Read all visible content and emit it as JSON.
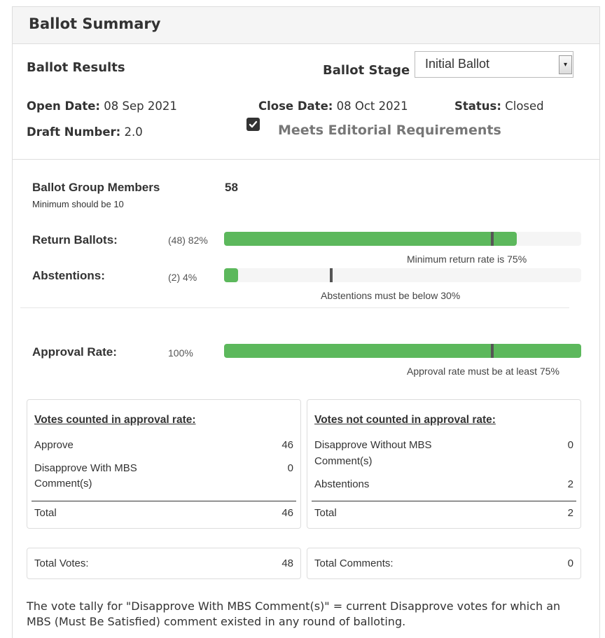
{
  "panel": {
    "title": "Ballot Summary"
  },
  "results": {
    "title": "Ballot Results",
    "stage_label": "Ballot Stage",
    "stage_value": "Initial Ballot",
    "open_date_label": "Open Date:",
    "open_date": "08 Sep 2021",
    "close_date_label": "Close Date:",
    "close_date": "08 Oct 2021",
    "status_label": "Status:",
    "status": "Closed",
    "draft_label": "Draft Number:",
    "draft": "2.0",
    "editorial_label": "Meets Editorial Requirements",
    "editorial_checked": true
  },
  "members": {
    "label": "Ballot Group Members",
    "value": "58",
    "note": "Minimum should be 10"
  },
  "return_ballots": {
    "label": "Return Ballots:",
    "value_text": "(48) 82%",
    "fill_percent": 82,
    "threshold_percent": 75,
    "note": "Minimum return rate is 75%"
  },
  "abstentions": {
    "label": "Abstentions:",
    "value_text": "(2) 4%",
    "fill_percent": 4,
    "threshold_percent": 30,
    "note": "Abstentions must be below 30%"
  },
  "approval": {
    "label": "Approval Rate:",
    "value_text": "100%",
    "fill_percent": 100,
    "threshold_percent": 75,
    "note": "Approval rate must be at least 75%"
  },
  "counted": {
    "title": "Votes counted in approval rate:",
    "approve_label": "Approve",
    "approve_value": "46",
    "disapprove_label_1": "Disapprove With MBS",
    "disapprove_label_2": "Comment(s)",
    "disapprove_value": "0",
    "total_label": "Total",
    "total_value": "46"
  },
  "not_counted": {
    "title": "Votes not counted in approval rate:",
    "disapprove_label_1": "Disapprove Without MBS",
    "disapprove_label_2": "Comment(s)",
    "disapprove_value": "0",
    "abstentions_label": "Abstentions",
    "abstentions_value": "2",
    "total_label": "Total",
    "total_value": "2"
  },
  "totals": {
    "votes_label": "Total Votes:",
    "votes_value": "48",
    "comments_label": "Total Comments:",
    "comments_value": "0"
  },
  "footnote": "The vote tally for \"Disapprove With MBS Comment(s)\" = current Disapprove votes for which an MBS (Must Be Satisfied) comment existed in any round of balloting.",
  "colors": {
    "bar_fill": "#5cb85c",
    "bar_track": "#f5f5f5",
    "marker": "#555555"
  }
}
